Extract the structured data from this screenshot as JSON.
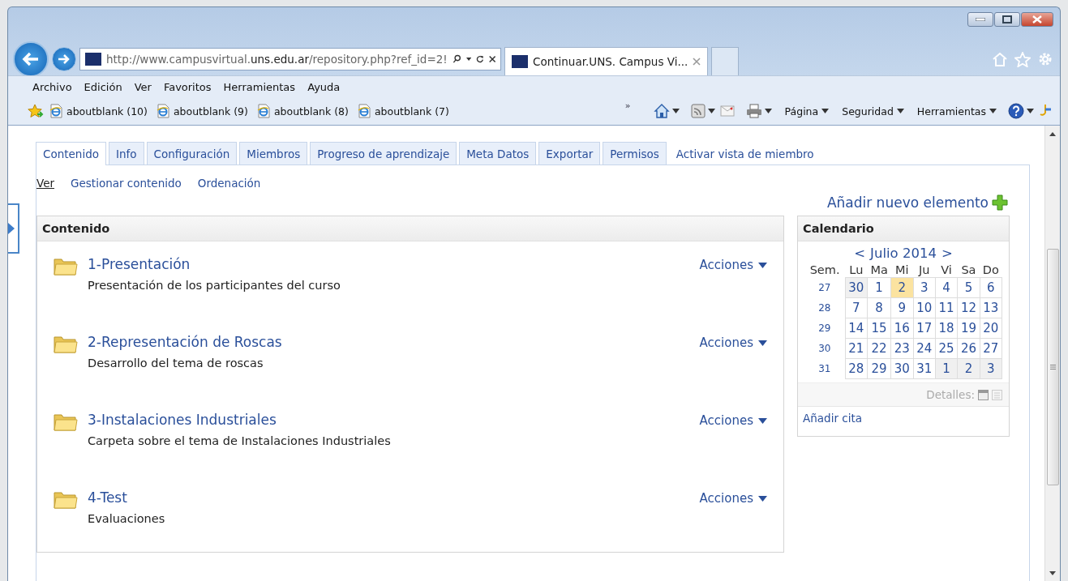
{
  "browser": {
    "address": {
      "prefix": "http://www.campusvirtual.",
      "domain": "uns.edu.ar",
      "suffix": "/repository.php?ref_id=2!"
    },
    "tabs": [
      {
        "title": "Continuar.UNS. Campus Vi...",
        "selected": true
      }
    ],
    "menu": [
      "Archivo",
      "Edición",
      "Ver",
      "Favoritos",
      "Herramientas",
      "Ayuda"
    ],
    "favorites": [
      "aboutblank (10)",
      "aboutblank (9)",
      "aboutblank (8)",
      "aboutblank (7)"
    ],
    "overflow": "»",
    "commands": [
      "Página",
      "Seguridad",
      "Herramientas"
    ]
  },
  "page": {
    "tabs": [
      {
        "label": "Contenido",
        "selected": true,
        "kind": "tab"
      },
      {
        "label": "Info",
        "selected": false,
        "kind": "tab"
      },
      {
        "label": "Configuración",
        "selected": false,
        "kind": "tab"
      },
      {
        "label": "Miembros",
        "selected": false,
        "kind": "tab"
      },
      {
        "label": "Progreso de aprendizaje",
        "selected": false,
        "kind": "tab"
      },
      {
        "label": "Meta Datos",
        "selected": false,
        "kind": "tab"
      },
      {
        "label": "Exportar",
        "selected": false,
        "kind": "tab"
      },
      {
        "label": "Permisos",
        "selected": false,
        "kind": "tab"
      },
      {
        "label": "Activar vista de miembro",
        "selected": false,
        "kind": "link"
      }
    ],
    "subtabs": [
      {
        "label": "Ver",
        "selected": true
      },
      {
        "label": "Gestionar contenido",
        "selected": false
      },
      {
        "label": "Ordenación",
        "selected": false
      }
    ],
    "add_item": "Añadir nuevo elemento",
    "content": {
      "title": "Contenido",
      "items": [
        {
          "title": "1-Presentación",
          "description": "Presentación de los participantes del curso",
          "actions": "Acciones"
        },
        {
          "title": "2-Representación de Roscas",
          "description": "Desarrollo del tema de roscas",
          "actions": "Acciones"
        },
        {
          "title": "3-Instalaciones Industriales",
          "description": "Carpeta sobre el tema de Instalaciones Industriales",
          "actions": "Acciones"
        },
        {
          "title": "4-Test",
          "description": "Evaluaciones",
          "actions": "Acciones"
        }
      ]
    },
    "calendar": {
      "title": "Calendario",
      "prev": "<",
      "month": "Julio 2014",
      "next": ">",
      "headers": [
        "Sem.",
        "Lu",
        "Ma",
        "Mi",
        "Ju",
        "Vi",
        "Sa",
        "Do"
      ],
      "weeks": [
        {
          "week": "27",
          "days": [
            {
              "day": "30",
              "outside": true,
              "selected": false
            },
            {
              "day": "1",
              "outside": false,
              "selected": false
            },
            {
              "day": "2",
              "outside": false,
              "selected": true
            },
            {
              "day": "3",
              "outside": false,
              "selected": false
            },
            {
              "day": "4",
              "outside": false,
              "selected": false
            },
            {
              "day": "5",
              "outside": false,
              "selected": false
            },
            {
              "day": "6",
              "outside": false,
              "selected": false
            }
          ]
        },
        {
          "week": "28",
          "days": [
            {
              "day": "7",
              "outside": false,
              "selected": false
            },
            {
              "day": "8",
              "outside": false,
              "selected": false
            },
            {
              "day": "9",
              "outside": false,
              "selected": false
            },
            {
              "day": "10",
              "outside": false,
              "selected": false
            },
            {
              "day": "11",
              "outside": false,
              "selected": false
            },
            {
              "day": "12",
              "outside": false,
              "selected": false
            },
            {
              "day": "13",
              "outside": false,
              "selected": false
            }
          ]
        },
        {
          "week": "29",
          "days": [
            {
              "day": "14",
              "outside": false,
              "selected": false
            },
            {
              "day": "15",
              "outside": false,
              "selected": false
            },
            {
              "day": "16",
              "outside": false,
              "selected": false
            },
            {
              "day": "17",
              "outside": false,
              "selected": false
            },
            {
              "day": "18",
              "outside": false,
              "selected": false
            },
            {
              "day": "19",
              "outside": false,
              "selected": false
            },
            {
              "day": "20",
              "outside": false,
              "selected": false
            }
          ]
        },
        {
          "week": "30",
          "days": [
            {
              "day": "21",
              "outside": false,
              "selected": false
            },
            {
              "day": "22",
              "outside": false,
              "selected": false
            },
            {
              "day": "23",
              "outside": false,
              "selected": false
            },
            {
              "day": "24",
              "outside": false,
              "selected": false
            },
            {
              "day": "25",
              "outside": false,
              "selected": false
            },
            {
              "day": "26",
              "outside": false,
              "selected": false
            },
            {
              "day": "27",
              "outside": false,
              "selected": false
            }
          ]
        },
        {
          "week": "31",
          "days": [
            {
              "day": "28",
              "outside": false,
              "selected": false
            },
            {
              "day": "29",
              "outside": false,
              "selected": false
            },
            {
              "day": "30",
              "outside": false,
              "selected": false
            },
            {
              "day": "31",
              "outside": false,
              "selected": false
            },
            {
              "day": "1",
              "outside": true,
              "selected": false
            },
            {
              "day": "2",
              "outside": true,
              "selected": false
            },
            {
              "day": "3",
              "outside": true,
              "selected": false
            }
          ]
        }
      ],
      "details": "Detalles:",
      "add": "Añadir cita"
    }
  }
}
